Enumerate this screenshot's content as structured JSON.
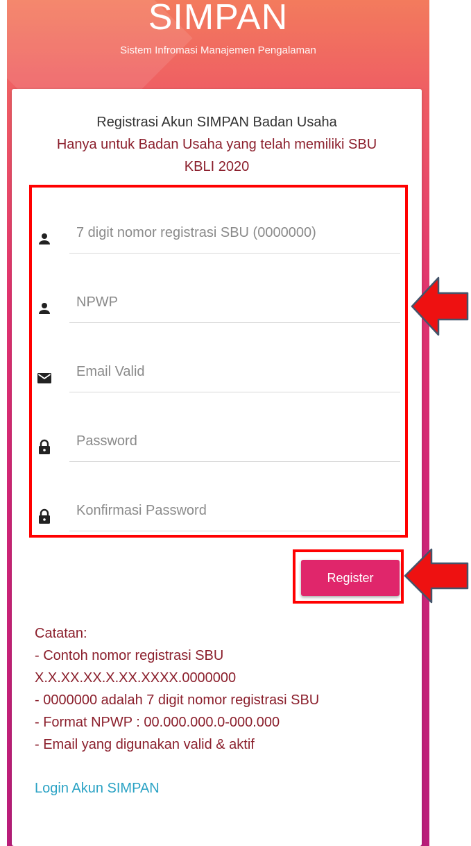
{
  "header": {
    "title": "SIMPAN",
    "subtitle": "Sistem Infromasi Manajemen Pengalaman"
  },
  "intro": {
    "line1": "Registrasi Akun SIMPAN Badan Usaha",
    "line2": "Hanya untuk Badan Usaha yang telah memiliki SBU",
    "line3": "KBLI 2020"
  },
  "form": {
    "fields": [
      {
        "icon": "person-icon",
        "placeholder": "7 digit nomor registrasi SBU (0000000)",
        "value": ""
      },
      {
        "icon": "person-icon",
        "placeholder": "NPWP",
        "value": ""
      },
      {
        "icon": "email-icon",
        "placeholder": "Email Valid",
        "value": ""
      },
      {
        "icon": "lock-icon",
        "placeholder": "Password",
        "value": ""
      },
      {
        "icon": "lock-icon",
        "placeholder": "Konfirmasi Password",
        "value": ""
      }
    ],
    "register_label": "Register"
  },
  "notes": {
    "title": "Catatan:",
    "lines": [
      "- Contoh nomor registrasi SBU",
      "X.X.XX.XX.X.XX.XXXX.0000000",
      "- 0000000 adalah 7 digit nomor registrasi SBU",
      "- Format NPWP : 00.000.000.0-000.000",
      "- Email yang digunakan valid & aktif"
    ]
  },
  "login_link": "Login Akun SIMPAN",
  "colors": {
    "accent": "#e0266b",
    "note_text": "#8b1f2c",
    "link": "#2aa2c4",
    "highlight": "#ff0000"
  }
}
